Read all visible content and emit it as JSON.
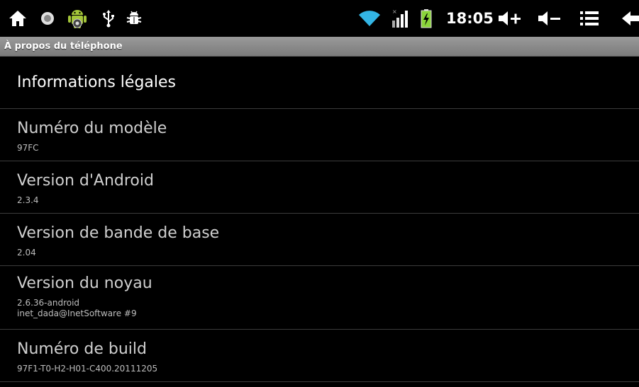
{
  "status_bar": {
    "left_icons": [
      "home-icon",
      "notification-dot-icon",
      "android-debug-icon",
      "usb-icon",
      "android-bug-icon"
    ],
    "right_icons": [
      "wifi-icon",
      "signal-icon",
      "battery-charging-icon",
      "volume-up-icon",
      "volume-down-icon",
      "menu-icon",
      "back-icon"
    ],
    "time": "18:05",
    "accent_colors": {
      "wifi": "#33b5e5",
      "battery": "#8ad43a",
      "android": "#a4c639"
    }
  },
  "title_bar": {
    "title": "À propos du téléphone"
  },
  "items": [
    {
      "title": "Informations légales",
      "subtitle": "",
      "subtitle2": ""
    },
    {
      "title": "Numéro du modèle",
      "subtitle": "97FC",
      "subtitle2": ""
    },
    {
      "title": "Version d'Android",
      "subtitle": "2.3.4",
      "subtitle2": ""
    },
    {
      "title": "Version de bande de base",
      "subtitle": "2.04",
      "subtitle2": ""
    },
    {
      "title": "Version du noyau",
      "subtitle": "2.6.36-android",
      "subtitle2": "inet_dada@InetSoftware #9"
    },
    {
      "title": "Numéro de build",
      "subtitle": "97F1-T0-H2-H01-C400.20111205",
      "subtitle2": ""
    }
  ]
}
